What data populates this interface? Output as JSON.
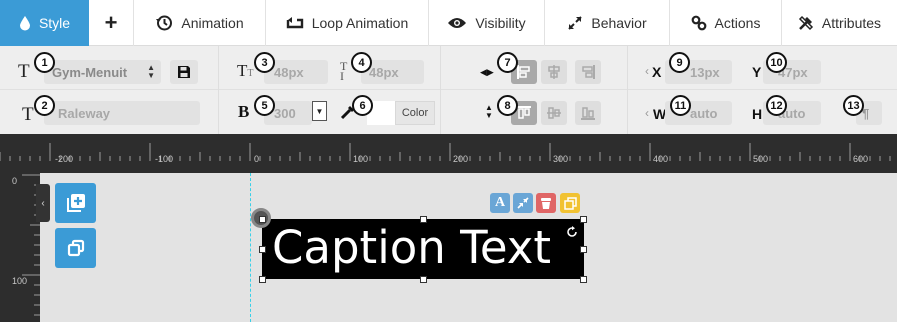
{
  "tabs": [
    {
      "label": "Style",
      "icon": "drop-icon",
      "active": true
    },
    {
      "label": "+",
      "icon": "plus-icon"
    },
    {
      "label": "Animation",
      "icon": "history-icon"
    },
    {
      "label": "Loop Animation",
      "icon": "loop-icon"
    },
    {
      "label": "Visibility",
      "icon": "eye-icon"
    },
    {
      "label": "Behavior",
      "icon": "arrows-icon"
    },
    {
      "label": "Actions",
      "icon": "link-icon"
    },
    {
      "label": "Attributes",
      "icon": "tools-icon"
    }
  ],
  "toolbar": {
    "font_style_select": "Gym-Menuit",
    "font_family": "Raleway",
    "font_size": "48px",
    "line_height": "48px",
    "font_weight": "300",
    "color_button": "Color",
    "x_label": "X",
    "x_value": "13px",
    "y_label": "Y",
    "y_value": "47px",
    "w_label": "W",
    "w_value": "auto",
    "h_label": "H",
    "h_value": "auto",
    "bold_label": "B",
    "paragraph_symbol": "¶"
  },
  "callouts": [
    "1",
    "2",
    "3",
    "4",
    "5",
    "6",
    "7",
    "8",
    "9",
    "10",
    "11",
    "12",
    "13"
  ],
  "ruler": {
    "h_labels": [
      "-200",
      "-100",
      "0",
      "100",
      "200",
      "300",
      "400",
      "500",
      "600"
    ],
    "v_labels": [
      "0",
      "100"
    ]
  },
  "canvas": {
    "caption_text": "Caption Text",
    "mini_buttons": [
      {
        "icon": "text-a-icon",
        "color": "#6aa6d6"
      },
      {
        "icon": "shrink-icon",
        "color": "#6aa6d6"
      },
      {
        "icon": "trash-icon",
        "color": "#e06666"
      },
      {
        "icon": "copy-icon",
        "color": "#f1c232"
      }
    ],
    "accent_color": "#3b9bd6",
    "guide_color": "#38d0e8"
  }
}
